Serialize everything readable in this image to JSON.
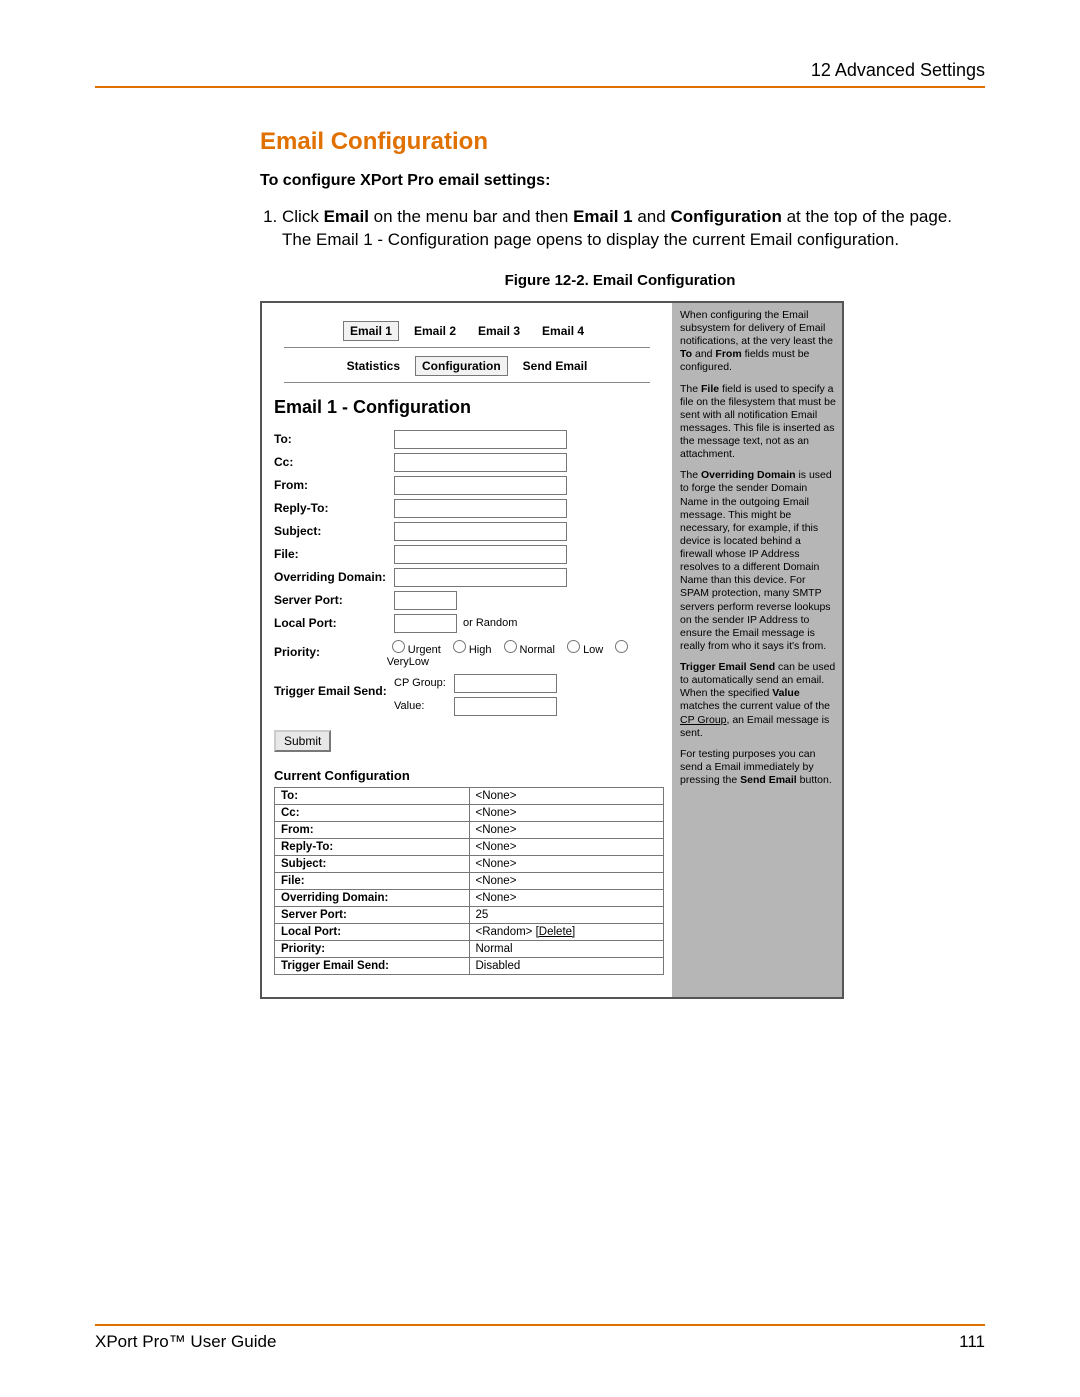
{
  "header": {
    "right": "12 Advanced Settings"
  },
  "section": {
    "title": "Email Configuration",
    "subheading": "To configure XPort Pro email settings:",
    "step1_prefix": "Click ",
    "step1_b1": "Email",
    "step1_mid1": " on the menu bar and then ",
    "step1_b2": "Email 1",
    "step1_mid2": " and ",
    "step1_b3": "Configuration",
    "step1_suffix": " at the top of the page. The Email 1 - Configuration page opens to display the current Email configuration.",
    "figcap": "Figure 12-2. Email Configuration"
  },
  "shot": {
    "tabs": [
      "Email 1",
      "Email 2",
      "Email 3",
      "Email 4"
    ],
    "active_tab": 0,
    "subtabs": [
      "Statistics",
      "Configuration",
      "Send Email"
    ],
    "active_subtab": 1,
    "panetitle": "Email 1 - Configuration",
    "labels": {
      "to": "To:",
      "cc": "Cc:",
      "from": "From:",
      "replyto": "Reply-To:",
      "subject": "Subject:",
      "file": "File:",
      "override": "Overriding Domain:",
      "serverport": "Server Port:",
      "localport": "Local Port:",
      "or_random": "or Random",
      "priority": "Priority:",
      "trigger": "Trigger Email Send:",
      "cpgroup": "CP Group:",
      "value": "Value:"
    },
    "priority_opts": [
      "Urgent",
      "High",
      "Normal",
      "Low",
      "VeryLow"
    ],
    "submit": "Submit",
    "curcfg_title": "Current Configuration",
    "curcfg": [
      [
        "To:",
        "<None>"
      ],
      [
        "Cc:",
        "<None>"
      ],
      [
        "From:",
        "<None>"
      ],
      [
        "Reply-To:",
        "<None>"
      ],
      [
        "Subject:",
        "<None>"
      ],
      [
        "File:",
        "<None>"
      ],
      [
        "Overriding Domain:",
        "<None>"
      ],
      [
        "Server Port:",
        "25"
      ],
      [
        "Local Port:",
        "<Random>  "
      ],
      [
        "Priority:",
        "Normal"
      ],
      [
        "Trigger Email Send:",
        "Disabled"
      ]
    ],
    "localport_delete": "[Delete]",
    "help": {
      "p1a": "When configuring the Email subsystem for delivery of Email notifications, at the very least the ",
      "p1b1": "To",
      "p1mid": " and ",
      "p1b2": "From",
      "p1c": " fields must be configured.",
      "p2a": "The ",
      "p2b": "File",
      "p2c": " field is used to specify a file on the filesystem that must be sent with all notification Email messages. This file is inserted as the message text, not as an attachment.",
      "p3a": "The ",
      "p3b": "Overriding Domain",
      "p3c": " is used to forge the sender Domain Name in the outgoing Email message. This might be necessary, for example, if this device is located behind a firewall whose IP Address resolves to a different Domain Name than this device. For SPAM protection, many SMTP servers perform reverse lookups on the sender IP Address to ensure the Email message is really from who it says it's from.",
      "p4b": "Trigger Email Send",
      "p4a": " can be used to automatically send an email. When the specified ",
      "p4b2": "Value",
      "p4c": " matches the current value of the ",
      "p4u": "CP Group",
      "p4d": ", an Email message is sent.",
      "p5a": "For testing purposes you can send a Email immediately by pressing the ",
      "p5b": "Send Email",
      "p5c": " button."
    }
  },
  "footer": {
    "left": "XPort Pro™ User Guide",
    "right": "111"
  }
}
